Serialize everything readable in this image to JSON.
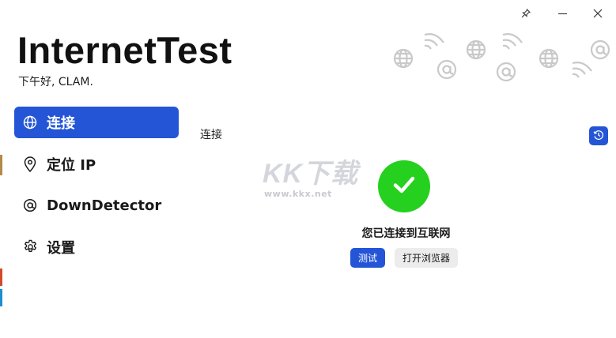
{
  "app": {
    "title": "InternetTest",
    "greeting": "下午好, CLAM."
  },
  "titlebar": {
    "pin_icon": "pin-icon",
    "minimize_icon": "minimize-icon",
    "close_icon": "close-icon"
  },
  "sidebar": {
    "items": [
      {
        "label": "连接",
        "icon": "globe-icon",
        "active": true
      },
      {
        "label": "定位 IP",
        "icon": "location-pin-icon",
        "active": false
      },
      {
        "label": "DownDetector",
        "icon": "at-sign-icon",
        "active": false
      },
      {
        "label": "设置",
        "icon": "gear-icon",
        "active": false
      }
    ]
  },
  "main": {
    "section_title": "连接",
    "history_icon": "history-icon",
    "status_icon": "checkmark-icon",
    "status_text": "您已连接到互联网",
    "test_button": "测试",
    "open_browser_button": "打开浏览器"
  },
  "watermark": {
    "logo": "KK下载",
    "url": "www.kkx.net"
  },
  "colors": {
    "accent": "#2455d6",
    "success": "#26d01e",
    "secondary_button": "#ececec"
  }
}
